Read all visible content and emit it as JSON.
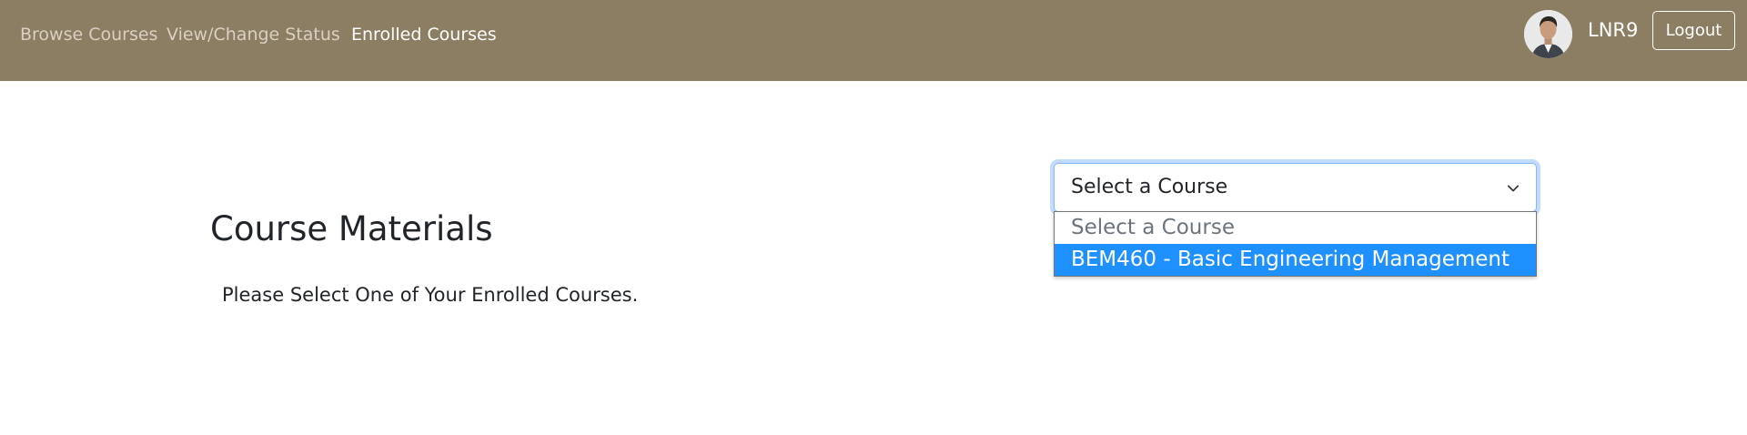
{
  "navbar": {
    "links": [
      {
        "label": "Browse Courses",
        "active": false
      },
      {
        "label": "View/Change Status",
        "active": false
      },
      {
        "label": "Enrolled Courses",
        "active": true
      }
    ],
    "username": "LNR9",
    "logout_label": "Logout",
    "background_color": "#8c7e62"
  },
  "main": {
    "title": "Course Materials",
    "instruction": "Please Select One of Your Enrolled Courses."
  },
  "course_select": {
    "value": "Select a Course",
    "icon": "chevron-down-icon",
    "options": [
      {
        "label": "Select a Course",
        "highlighted": false
      },
      {
        "label": "BEM460 - Basic Engineering Management",
        "highlighted": true
      }
    ],
    "highlight_color": "#1e90ff"
  }
}
